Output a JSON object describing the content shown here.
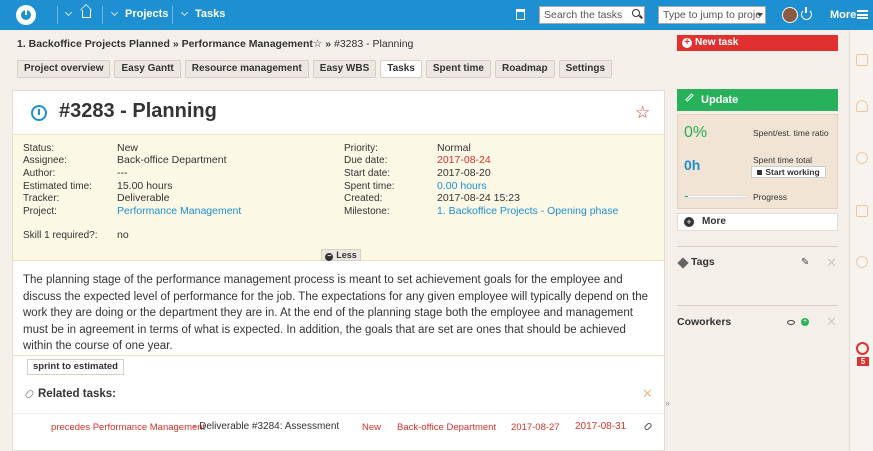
{
  "topbar": {
    "nav_projects": "Projects",
    "nav_tasks": "Tasks",
    "search_placeholder": "Search the tasks",
    "jump_placeholder": "Type to jump to proje",
    "more_label": "More",
    "accent_color": "#1e8fd1"
  },
  "breadcrumb": {
    "project": "1. Backoffice Projects Planned",
    "subproject": "Performance Management",
    "star": "☆",
    "issue": "#3283 - Planning"
  },
  "tabs": [
    "Project overview",
    "Easy Gantt",
    "Resource management",
    "Easy WBS",
    "Tasks",
    "Spent time",
    "Roadmap",
    "Settings"
  ],
  "issue": {
    "title": "#3283 - Planning",
    "favorite_icon": "☆",
    "attributes_left": [
      {
        "label": "Status:",
        "value": "New",
        "style": "plain"
      },
      {
        "label": "Assignee:",
        "value": "Back-office Department",
        "style": "plain"
      },
      {
        "label": "Author:",
        "value": "---",
        "style": "plain"
      },
      {
        "label": "Estimated time:",
        "value": "15.00 hours",
        "style": "plain"
      },
      {
        "label": "Tracker:",
        "value": "Deliverable",
        "style": "plain"
      },
      {
        "label": "Project:",
        "value": "Performance Management",
        "style": "blue"
      }
    ],
    "attributes_right": [
      {
        "label": "Priority:",
        "value": "Normal",
        "style": "plain"
      },
      {
        "label": "Due date:",
        "value": "2017-08-24",
        "style": "red"
      },
      {
        "label": "Start date:",
        "value": "2017-08-20",
        "style": "plain"
      },
      {
        "label": "Spent time:",
        "value": "0.00 hours",
        "style": "blue"
      },
      {
        "label": "Created:",
        "value": "2017-08-24 15:23",
        "style": "plain"
      },
      {
        "label": "Milestone:",
        "value": "1. Backoffice Projects - Opening phase",
        "style": "blue"
      }
    ],
    "skill_label": "Skill 1 required?:",
    "skill_value": "no",
    "less_label": "Less",
    "description": "The planning stage of the performance management process is meant to set achievement goals for the employee and discuss the expected level of performance for the job. The expectations for any given employee will typically depend on the work they are doing or the department they are in. At the end of the planning stage both the employee and management must be in agreement in terms of what is expected. In addition, the goals that are set are ones that should be achieved within the course of one year.",
    "tag_chip": "sprint to estimated"
  },
  "related": {
    "heading": "Related tasks:",
    "rows": [
      {
        "relation": "precedes Performance Management",
        "task": " - Deliverable #3284: Assessment",
        "status": "New",
        "assignee": "Back-office Department",
        "start": "2017-08-27",
        "due": "2017-08-31"
      }
    ]
  },
  "sidebar": {
    "new_task": "New task",
    "update": "Update",
    "percent": "0%",
    "spent_ratio_label": "Spent/est. time ratio",
    "hours": "0h",
    "spent_total_label": "Spent time total",
    "start_working": "Start working",
    "progress_label": "Progress",
    "progress_value": 0.05,
    "more": "More",
    "tags_title": "Tags",
    "coworkers_title": "Coworkers",
    "badge_count": "5",
    "green": "#27b15a",
    "red": "#e03030"
  }
}
